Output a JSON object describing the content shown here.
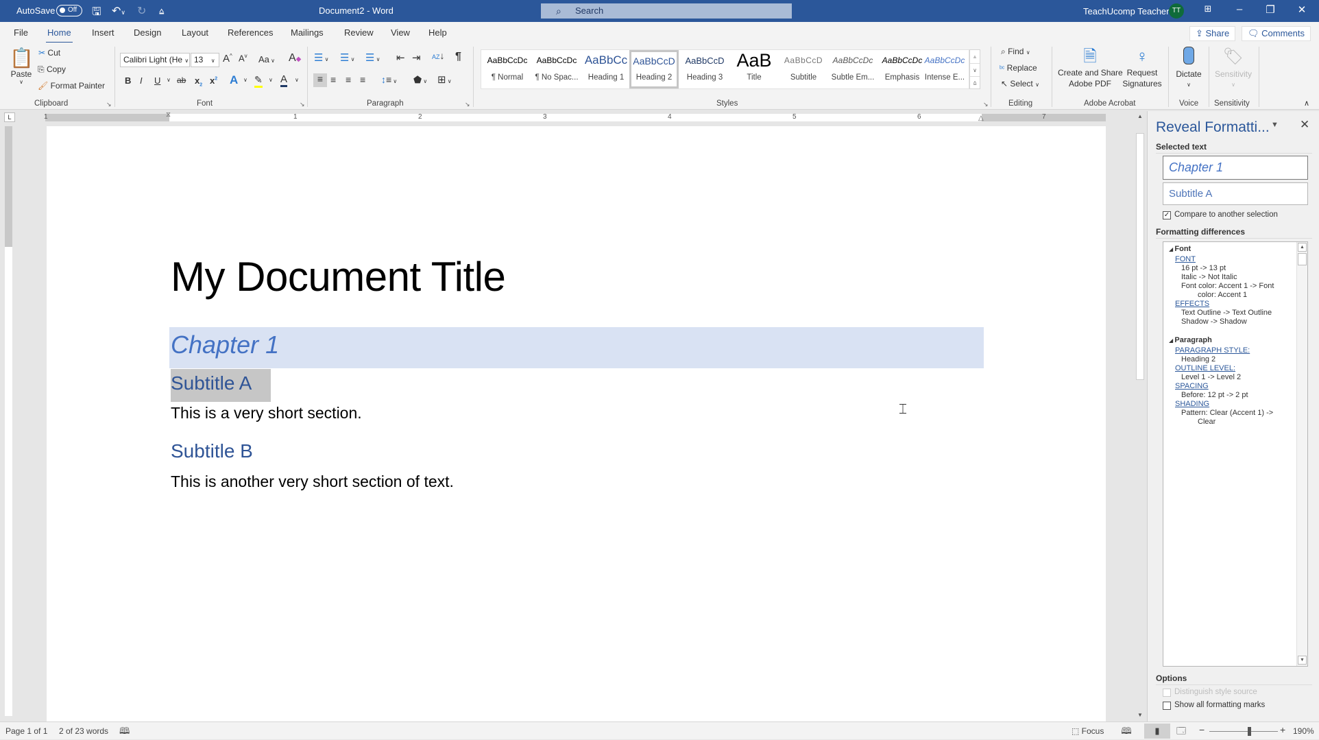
{
  "titlebar": {
    "autosave_label": "AutoSave",
    "autosave_state": "Off",
    "doc_title": "Document2  -  Word",
    "search_placeholder": "Search",
    "user_name": "TeachUcomp Teacher",
    "user_initials": "TT"
  },
  "tabs": [
    "File",
    "Home",
    "Insert",
    "Design",
    "Layout",
    "References",
    "Mailings",
    "Review",
    "View",
    "Help"
  ],
  "active_tab": "Home",
  "share_label": "Share",
  "comments_label": "Comments",
  "ribbon": {
    "clipboard": {
      "label": "Clipboard",
      "paste": "Paste",
      "cut": "Cut",
      "copy": "Copy",
      "format_painter": "Format Painter"
    },
    "font": {
      "label": "Font",
      "font_name": "Calibri Light (He",
      "font_size": "13",
      "change_case": "Aa"
    },
    "paragraph": {
      "label": "Paragraph"
    },
    "styles": {
      "label": "Styles",
      "items": [
        {
          "preview": "AaBbCcDc",
          "name": "¶ Normal"
        },
        {
          "preview": "AaBbCcDc",
          "name": "¶ No Spac..."
        },
        {
          "preview": "AaBbCc",
          "name": "Heading 1"
        },
        {
          "preview": "AaBbCcD",
          "name": "Heading 2",
          "selected": true
        },
        {
          "preview": "AaBbCcD",
          "name": "Heading 3"
        },
        {
          "preview": "AaB",
          "name": "Title"
        },
        {
          "preview": "AaBbCcD",
          "name": "Subtitle"
        },
        {
          "preview": "AaBbCcDc",
          "name": "Subtle Em..."
        },
        {
          "preview": "AaBbCcDc",
          "name": "Emphasis"
        },
        {
          "preview": "AaBbCcDc",
          "name": "Intense E..."
        }
      ]
    },
    "editing": {
      "label": "Editing",
      "find": "Find",
      "replace": "Replace",
      "select": "Select"
    },
    "acrobat": {
      "label": "Adobe Acrobat",
      "create_line1": "Create and Share",
      "create_line2": "Adobe PDF",
      "request_line1": "Request",
      "request_line2": "Signatures"
    },
    "voice": {
      "label": "Voice",
      "dictate": "Dictate"
    },
    "sensitivity": {
      "label": "Sensitivity",
      "button": "Sensitivity"
    }
  },
  "ruler": {
    "numbers": [
      "1",
      "1",
      "2",
      "3",
      "4",
      "5",
      "6",
      "7"
    ]
  },
  "document": {
    "title": "My Document Title",
    "chapter": "Chapter 1",
    "subtitle_a": "Subtitle A",
    "body_1": "This is a very short section.",
    "subtitle_b": "Subtitle B",
    "body_2": "This is another very short section of text."
  },
  "pane": {
    "title": "Reveal Formatti...",
    "selected_text_label": "Selected text",
    "selection_1": "Chapter 1",
    "selection_2": "Subtitle A",
    "compare_label": "Compare to another selection",
    "compare_checked": true,
    "differences_label": "Formatting differences",
    "differences": [
      {
        "type": "section",
        "text": "Font"
      },
      {
        "type": "link",
        "text": "FONT"
      },
      {
        "type": "item",
        "text": "16 pt -> 13 pt"
      },
      {
        "type": "item",
        "text": "Italic -> Not Italic"
      },
      {
        "type": "item",
        "text": "Font color: Accent 1 -> Font"
      },
      {
        "type": "cont",
        "text": "color: Accent 1"
      },
      {
        "type": "link",
        "text": "EFFECTS"
      },
      {
        "type": "item",
        "text": "Text Outline -> Text Outline"
      },
      {
        "type": "item",
        "text": "Shadow -> Shadow"
      },
      {
        "type": "gap",
        "text": ""
      },
      {
        "type": "section",
        "text": "Paragraph"
      },
      {
        "type": "link",
        "text": "PARAGRAPH STYLE:"
      },
      {
        "type": "item",
        "text": "Heading 2"
      },
      {
        "type": "link",
        "text": "OUTLINE LEVEL:"
      },
      {
        "type": "item",
        "text": "Level 1 -> Level 2"
      },
      {
        "type": "link",
        "text": "SPACING"
      },
      {
        "type": "item",
        "text": "Before:  12 pt ->  2 pt"
      },
      {
        "type": "link",
        "text": "SHADING"
      },
      {
        "type": "item",
        "text": "Pattern: Clear (Accent 1) ->"
      },
      {
        "type": "cont",
        "text": "Clear"
      }
    ],
    "options_label": "Options",
    "distinguish_label": "Distinguish style source",
    "distinguish_checked": false,
    "show_marks_label": "Show all formatting marks",
    "show_marks_checked": false
  },
  "status": {
    "page": "Page 1 of 1",
    "words": "2 of 23 words",
    "focus": "Focus",
    "zoom_level": "190%",
    "zoom_percent": 190
  },
  "colors": {
    "brand": "#2b579a",
    "accent1": "#4472c4",
    "heading_blue": "#2f5496",
    "chapter_shading": "#d9e2f3"
  }
}
